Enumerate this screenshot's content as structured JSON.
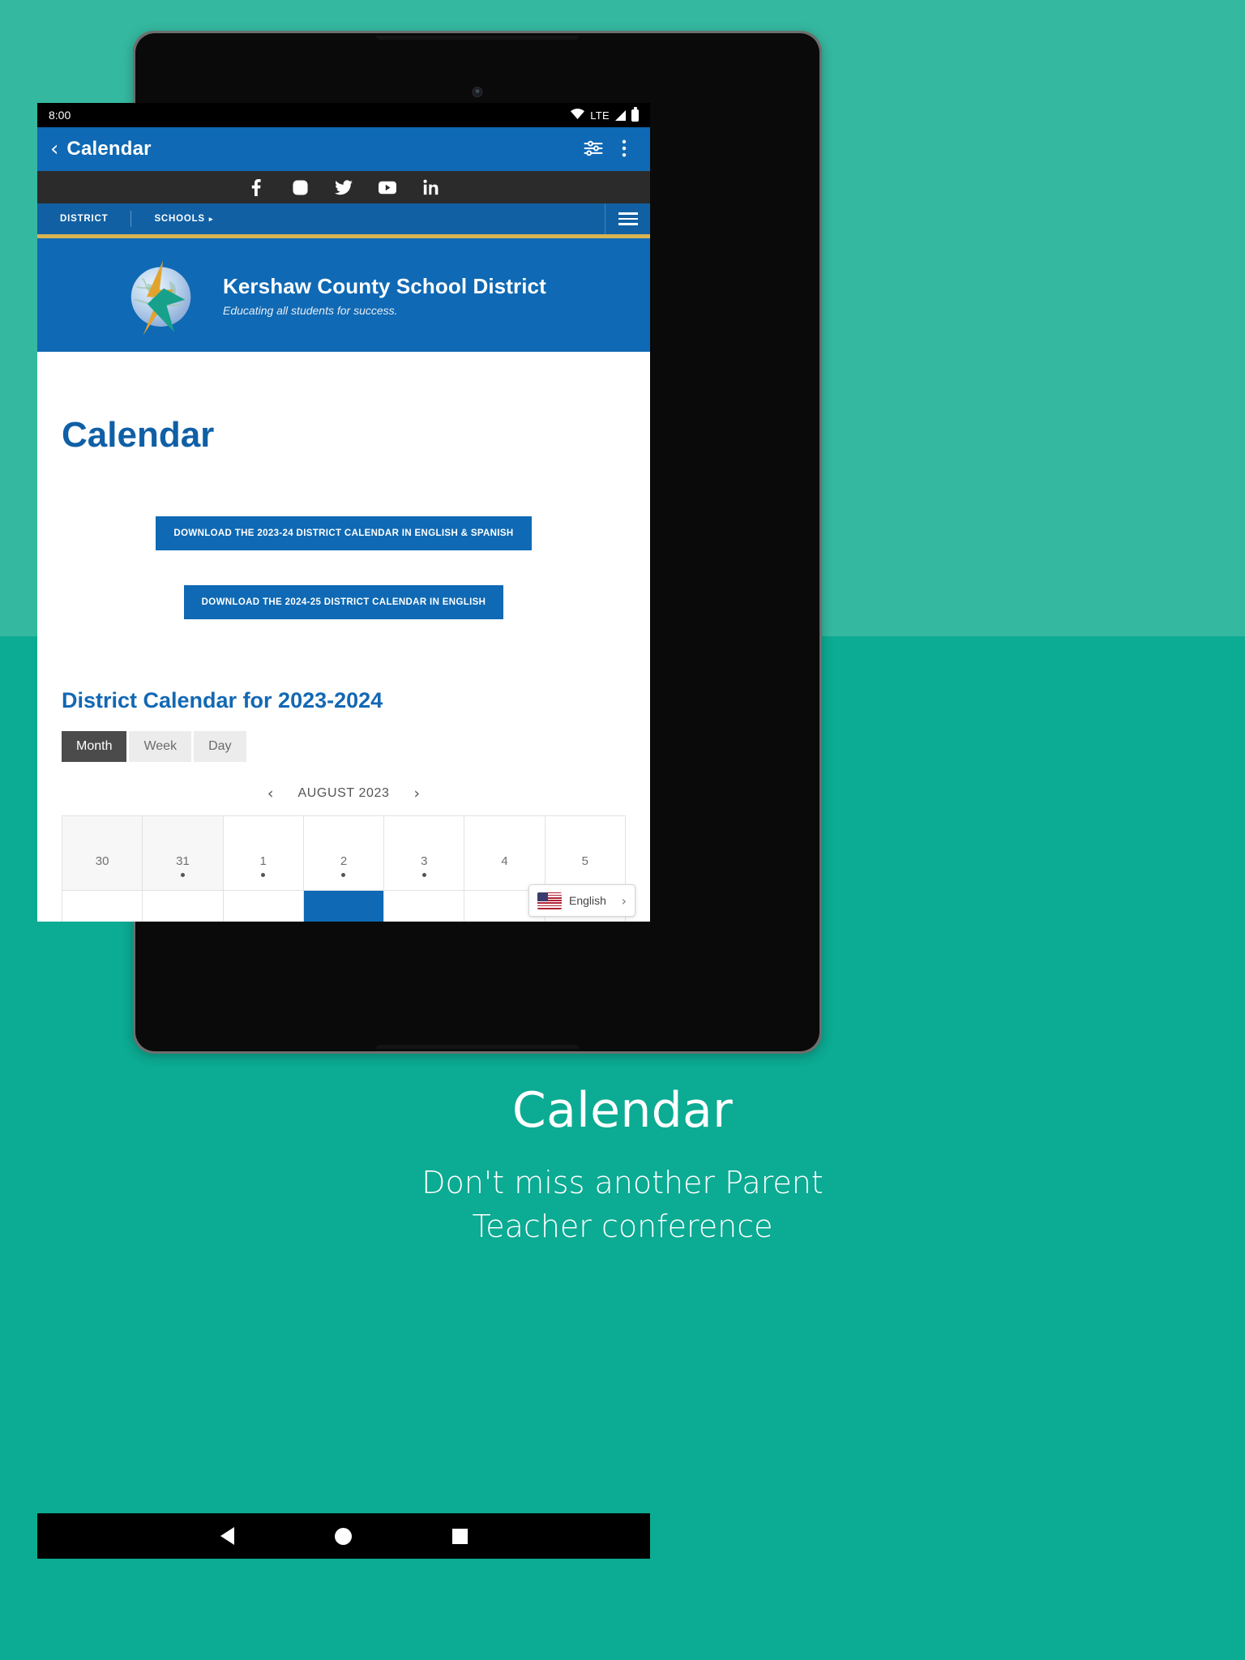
{
  "status_bar": {
    "time": "8:00",
    "network_label": "LTE",
    "icons": [
      "wifi-icon",
      "lte-label",
      "signal-icon",
      "battery-icon"
    ]
  },
  "app_bar": {
    "back_label": "‹",
    "title": "Calendar",
    "icons": [
      "tune-icon",
      "overflow-menu-icon"
    ]
  },
  "social_bar": {
    "items": [
      {
        "name": "facebook-icon",
        "label": "Facebook"
      },
      {
        "name": "instagram-icon",
        "label": "Instagram"
      },
      {
        "name": "twitter-icon",
        "label": "Twitter"
      },
      {
        "name": "youtube-icon",
        "label": "YouTube"
      },
      {
        "name": "linkedin-icon",
        "label": "LinkedIn"
      }
    ]
  },
  "district_nav": {
    "district_label": "DISTRICT",
    "schools_label": "SCHOOLS",
    "schools_caret": "▸",
    "menu_icon": "hamburger-menu-icon"
  },
  "header": {
    "district_name": "Kershaw County School District",
    "tagline": "Educating all students for success.",
    "logo_name": "kcsd-globe-logo"
  },
  "page": {
    "title": "Calendar",
    "download_buttons": [
      "DOWNLOAD THE 2023-24 DISTRICT CALENDAR IN ENGLISH & SPANISH",
      "DOWNLOAD THE 2024-25 DISTRICT CALENDAR IN ENGLISH"
    ],
    "section_title": "District Calendar for 2023-2024"
  },
  "calendar": {
    "view_tabs": [
      {
        "label": "Month",
        "active": true
      },
      {
        "label": "Week",
        "active": false
      },
      {
        "label": "Day",
        "active": false
      }
    ],
    "prev_label": "‹",
    "next_label": "›",
    "month_label": "AUGUST 2023",
    "days": [
      {
        "num": "30",
        "other_month": true,
        "has_event": false,
        "selected": false
      },
      {
        "num": "31",
        "other_month": true,
        "has_event": true,
        "selected": false
      },
      {
        "num": "1",
        "other_month": false,
        "has_event": true,
        "selected": false
      },
      {
        "num": "2",
        "other_month": false,
        "has_event": true,
        "selected": false
      },
      {
        "num": "3",
        "other_month": false,
        "has_event": true,
        "selected": false
      },
      {
        "num": "4",
        "other_month": false,
        "has_event": false,
        "selected": false
      },
      {
        "num": "5",
        "other_month": false,
        "has_event": false,
        "selected": false
      },
      {
        "num": "",
        "other_month": false,
        "has_event": false,
        "selected": false
      },
      {
        "num": "",
        "other_month": false,
        "has_event": false,
        "selected": false
      },
      {
        "num": "",
        "other_month": false,
        "has_event": false,
        "selected": false
      },
      {
        "num": "",
        "other_month": false,
        "has_event": false,
        "selected": true
      },
      {
        "num": "",
        "other_month": false,
        "has_event": false,
        "selected": false
      },
      {
        "num": "",
        "other_month": false,
        "has_event": false,
        "selected": false
      },
      {
        "num": "",
        "other_month": false,
        "has_event": false,
        "selected": false
      }
    ]
  },
  "language_widget": {
    "flag_icon": "us-flag-icon",
    "label": "English",
    "chevron": "›"
  },
  "nav_bar": {
    "back": "back-triangle-icon",
    "home": "home-circle-icon",
    "recents": "recents-square-icon"
  },
  "caption": {
    "title": "Calendar",
    "subtitle_line1": "Don't miss another Parent",
    "subtitle_line2": "Teacher conference"
  },
  "colors": {
    "background_top": "#35b8a0",
    "background_bottom": "#0cab93",
    "brand_blue": "#0f69b4",
    "nav_blue": "#1160a4",
    "gold_rule": "#d9b452",
    "heading_blue": "#1368b3"
  }
}
